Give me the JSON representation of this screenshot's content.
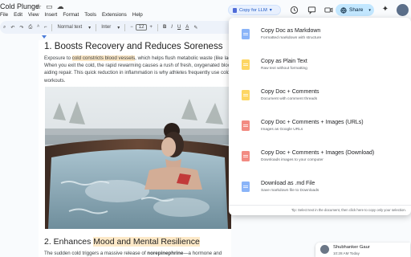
{
  "doc": {
    "title": "Cold Plunge",
    "menu": [
      "File",
      "Edit",
      "View",
      "Insert",
      "Format",
      "Tools",
      "Extensions",
      "Help"
    ]
  },
  "topbar": {
    "copy_llm_label": "Copy for LLM",
    "share_label": "Share"
  },
  "toolbar": {
    "style_value": "Normal text",
    "font_value": "Inter",
    "font_size": "12",
    "minus": "−",
    "plus": "+"
  },
  "content": {
    "heading1": "1. Boosts Recovery and Reduces Soreness",
    "para1_pre": "Exposure to ",
    "para1_highlight": "cold constricts blood vessels",
    "para1_mid": ", which helps flush metabolic waste (like lactic acid) from muscles. When you exit the cold, the rapid rewarming causes a rush of fresh, oxygenated blood back to the tissues, aiding repair. This quick reduction in inflammation is why athletes frequently use cold plunges after intense workouts.",
    "heading2_pre": "2. Enhances ",
    "heading2_highlight": "Mood and Mental Resilience",
    "para2_pre": "The sudden cold triggers a massive release of ",
    "para2_bold": "norepinephrine",
    "para2_post": "—a hormone and"
  },
  "menu": {
    "items": [
      {
        "title": "Copy Doc as Markdown",
        "subtitle": "Formatted markdown with structure",
        "color": "#8ab4f8"
      },
      {
        "title": "Copy as Plain Text",
        "subtitle": "Raw text without formatting",
        "color": "#fdd663"
      },
      {
        "title": "Copy Doc + Comments",
        "subtitle": "Document with comment threads",
        "color": "#fdd663"
      },
      {
        "title": "Copy Doc + Comments + Images (URLs)",
        "subtitle": "Images as Google URLs",
        "color": "#f28b82"
      },
      {
        "title": "Copy Doc + Comments + Images (Download)",
        "subtitle": "Downloads images to your computer",
        "color": "#f28b82"
      },
      {
        "title": "Download as .md File",
        "subtitle": "Save markdown file to Downloads",
        "color": "#8ab4f8"
      }
    ],
    "tip": "Tip: Select text in the document, then click here to copy only your selection."
  },
  "comment": {
    "name": "Shubhanker Gaur",
    "time": "10:28 AM Today"
  },
  "colors": {
    "share_bg": "#c2e7ff",
    "highlight": "#fbe7c6",
    "accent": "#1a56c4"
  }
}
